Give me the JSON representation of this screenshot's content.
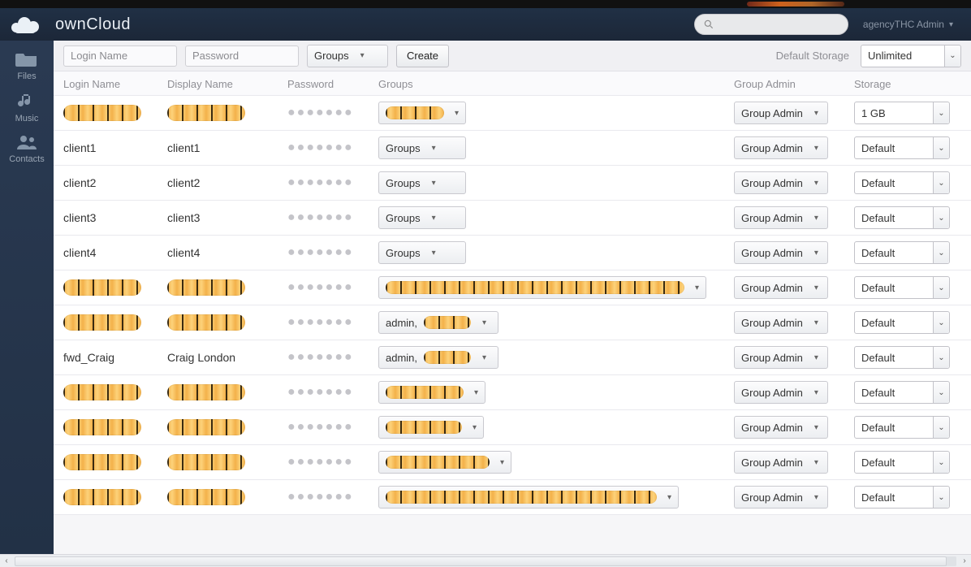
{
  "brand": {
    "name": "ownCloud"
  },
  "header": {
    "search_placeholder": "",
    "user_label": "agencyTHC Admin"
  },
  "sidebar": {
    "items": [
      {
        "label": "Files",
        "icon": "files-icon"
      },
      {
        "label": "Music",
        "icon": "music-icon"
      },
      {
        "label": "Contacts",
        "icon": "contacts-icon"
      }
    ]
  },
  "toolbar": {
    "login_placeholder": "Login Name",
    "password_placeholder": "Password",
    "groups_label": "Groups",
    "create_label": "Create",
    "default_storage_label": "Default Storage",
    "default_storage_value": "Unlimited"
  },
  "columns": {
    "login": "Login Name",
    "display": "Display Name",
    "password": "Password",
    "groups": "Groups",
    "group_admin": "Group Admin",
    "storage": "Storage"
  },
  "password_mask": "●●●●●●●",
  "labels": {
    "groups": "Groups",
    "group_admin": "Group Admin",
    "default": "Default",
    "one_gb": "1 GB",
    "admin_prefix": "admin,"
  },
  "rows": [
    {
      "login_redacted": true,
      "display_redacted": true,
      "groups_mode": "redacted",
      "groups_width": 108,
      "storage": "1 GB"
    },
    {
      "login": "client1",
      "display": "client1",
      "groups_mode": "label",
      "storage": "Default"
    },
    {
      "login": "client2",
      "display": "client2",
      "groups_mode": "label",
      "storage": "Default"
    },
    {
      "login": "client3",
      "display": "client3",
      "groups_mode": "label",
      "storage": "Default"
    },
    {
      "login": "client4",
      "display": "client4",
      "groups_mode": "label",
      "storage": "Default"
    },
    {
      "login_redacted": true,
      "display_redacted": true,
      "groups_mode": "redacted",
      "groups_width": 404,
      "storage": "Default"
    },
    {
      "login_redacted": true,
      "display_redacted": true,
      "groups_mode": "admin_redacted",
      "groups_width": 148,
      "storage": "Default"
    },
    {
      "login": "fwd_Craig",
      "display": "Craig London",
      "groups_mode": "admin_redacted",
      "groups_width": 148,
      "storage": "Default"
    },
    {
      "login_redacted": true,
      "display_redacted": true,
      "groups_mode": "redacted",
      "groups_width": 132,
      "storage": "Default"
    },
    {
      "login_redacted": true,
      "display_redacted": true,
      "groups_mode": "redacted",
      "groups_width": 130,
      "storage": "Default"
    },
    {
      "login_redacted": true,
      "display_redacted": true,
      "groups_mode": "redacted",
      "groups_width": 164,
      "storage": "Default"
    },
    {
      "login_redacted": true,
      "display_redacted": true,
      "groups_mode": "redacted",
      "groups_width": 370,
      "storage": "Default"
    }
  ]
}
